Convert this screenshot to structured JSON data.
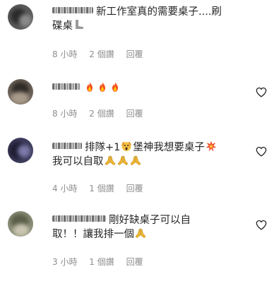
{
  "comments": [
    {
      "text": "新工作室真的需要桌子....刷碟桌🦵",
      "line1": "新工作室真的需要桌子....刷",
      "line2": "碟桌",
      "time": "8 小時",
      "likes": "2 個讚",
      "reply": "回覆"
    },
    {
      "text": "🔥🔥🔥",
      "time": "8 小時",
      "likes": "2 個讚",
      "reply": "回覆"
    },
    {
      "text": "排隊+1😱堡神我想要桌子💥我可以自取🙏🙏🙏",
      "line1": "排隊+1",
      "line1b": "堡神我想要桌子",
      "line2": "我可以自取",
      "time": "4 小時",
      "likes": "1 個讚",
      "reply": "回覆"
    },
    {
      "text": "剛好缺桌子可以自取！！讓我排一個🙏",
      "line1": "剛好缺桌子可以自",
      "line2": "取！！讓我排一個",
      "time": "3 小時",
      "likes": "1 個讚",
      "reply": "回覆"
    }
  ],
  "icons": {
    "heart": "heart-outline-icon",
    "fire": "fire-emoji",
    "pray": "folded-hands-emoji",
    "scream": "scream-emoji",
    "collision": "collision-emoji",
    "leg": "leg-emoji"
  }
}
